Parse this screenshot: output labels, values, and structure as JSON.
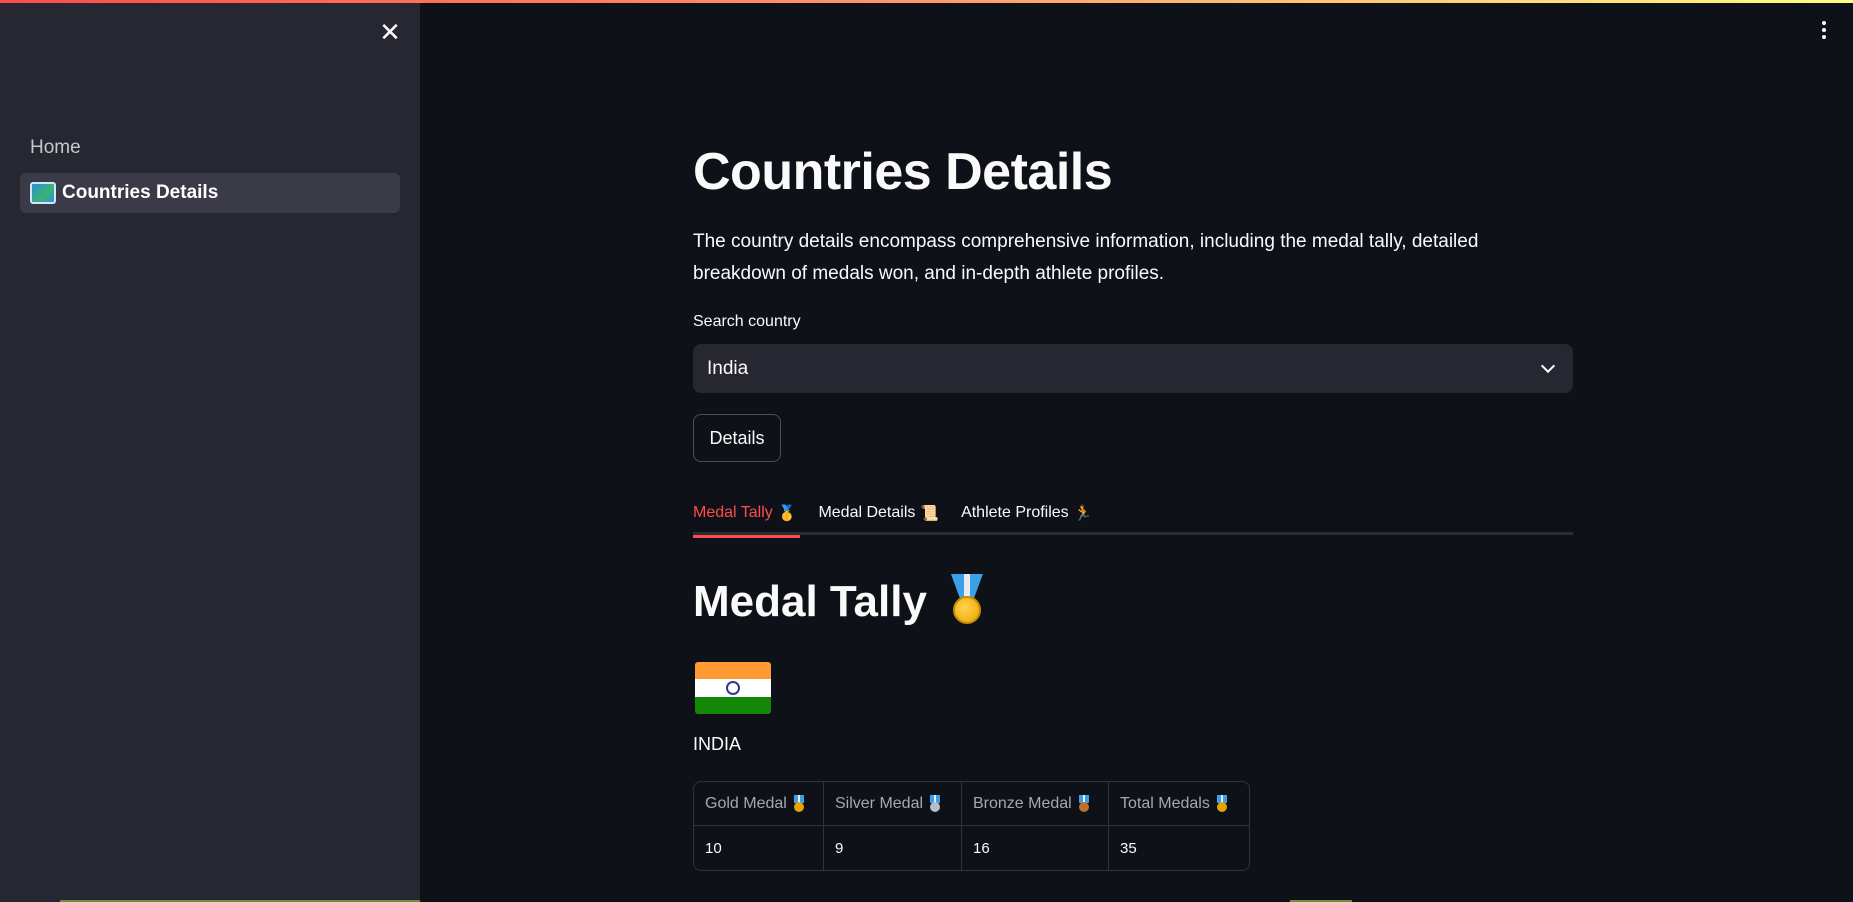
{
  "sidebar": {
    "close_symbol": "✕",
    "items": [
      {
        "label": "Home",
        "icon": ""
      },
      {
        "label": "Countries Details",
        "icon": "map-icon"
      }
    ]
  },
  "header": {
    "menu_icon": "kebab-menu-icon"
  },
  "main": {
    "title": "Countries Details",
    "description": "The country details encompass comprehensive information, including the medal tally, detailed breakdown of medals won, and in-depth athlete profiles.",
    "search": {
      "label": "Search country",
      "selected": "India"
    },
    "details_button": "Details",
    "tabs": [
      {
        "label": "Medal Tally",
        "emoji": "🥇"
      },
      {
        "label": "Medal Details",
        "emoji": "📜"
      },
      {
        "label": "Athlete Profiles",
        "emoji": "🏃"
      }
    ],
    "section_title": "Medal Tally",
    "country_name": "INDIA",
    "table": {
      "headers": [
        "Gold Medal",
        "Silver Medal",
        "Bronze Medal",
        "Total Medals"
      ],
      "values": [
        "10",
        "9",
        "16",
        "35"
      ]
    }
  },
  "colors": {
    "accent": "#ff4b4b",
    "background": "#0e1117",
    "sidebar": "#262730"
  }
}
